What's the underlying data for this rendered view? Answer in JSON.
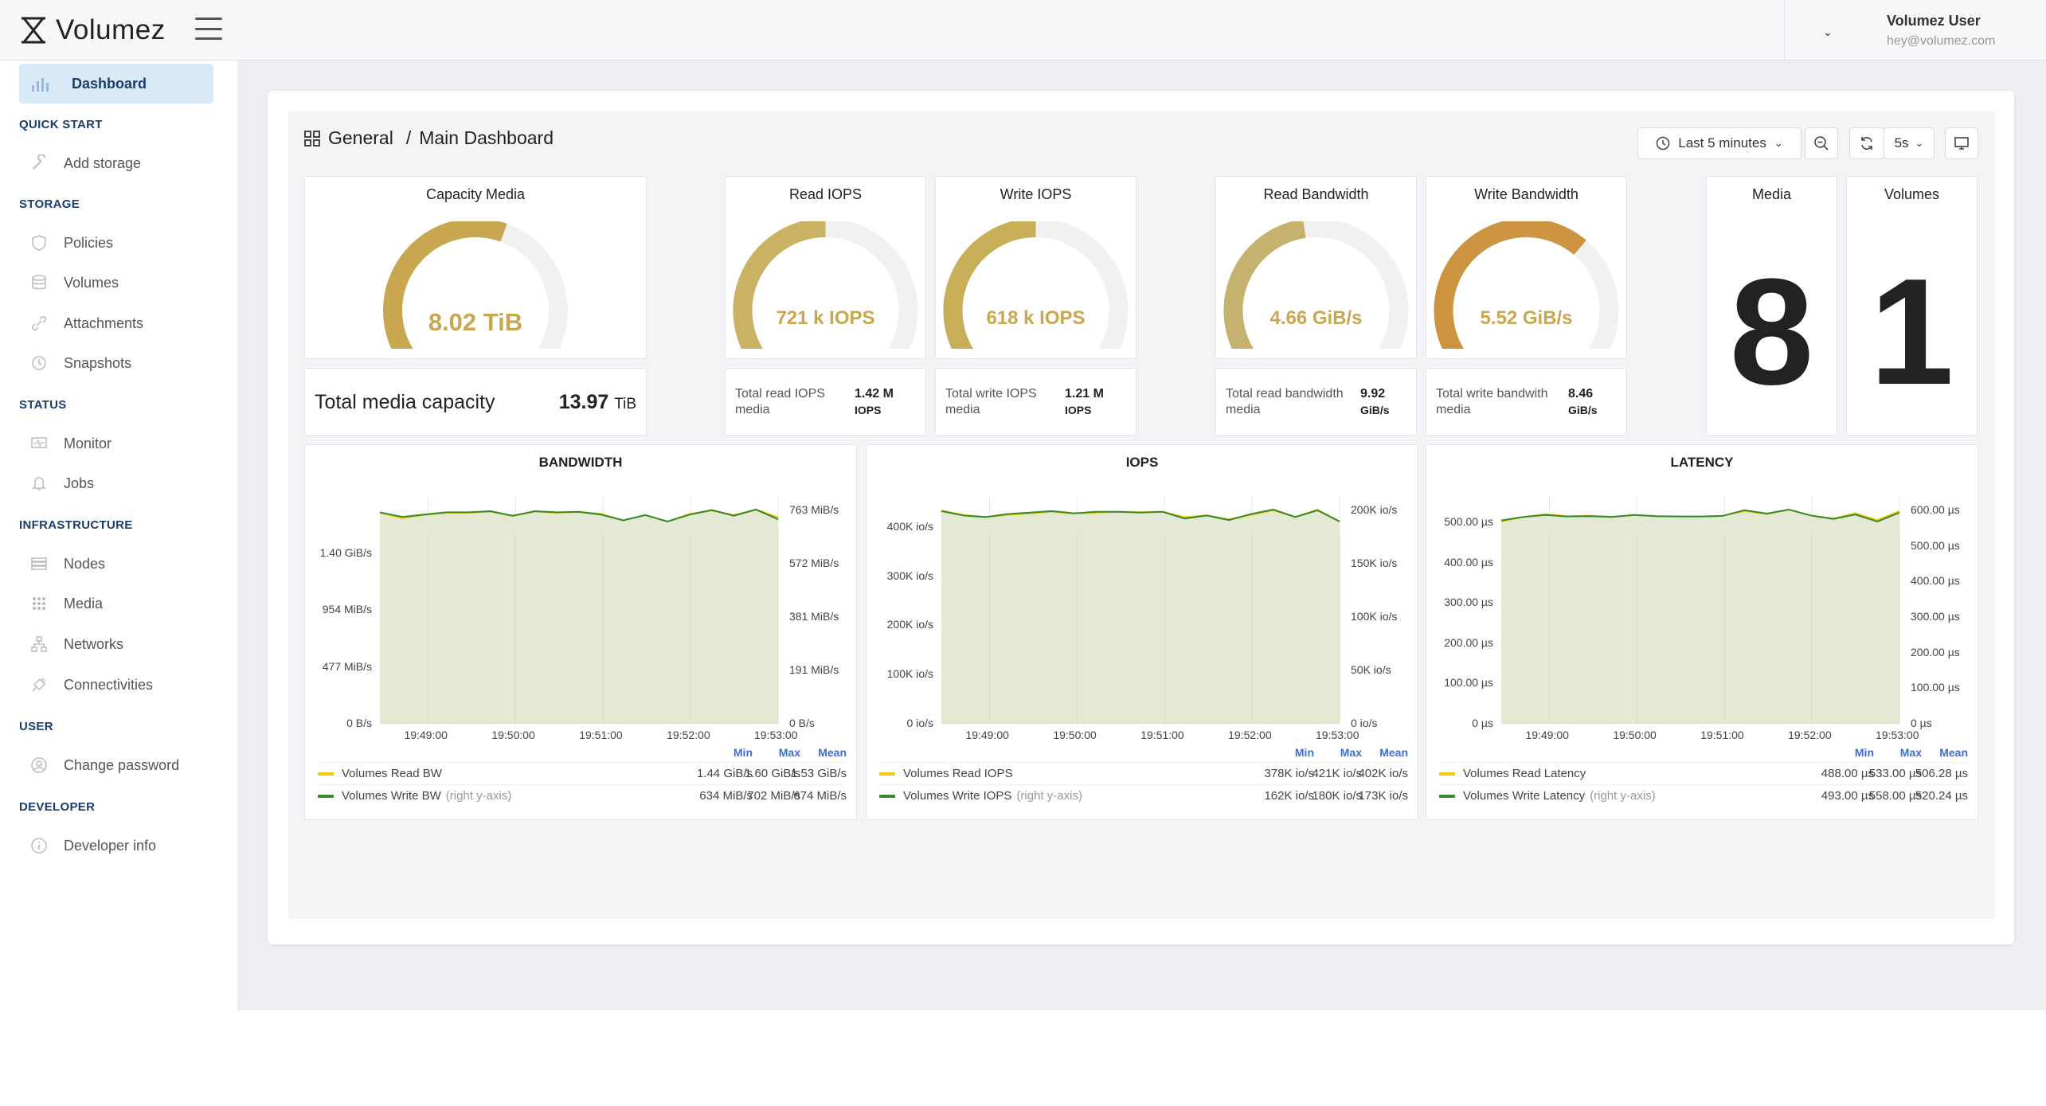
{
  "app": {
    "name": "Volumez"
  },
  "user": {
    "name": "Volumez User",
    "email": "hey@volumez.com"
  },
  "sidebar": {
    "dashboard": "Dashboard",
    "sections": [
      {
        "title": "QUICK START",
        "items": [
          "Add storage"
        ]
      },
      {
        "title": "STORAGE",
        "items": [
          "Policies",
          "Volumes",
          "Attachments",
          "Snapshots"
        ]
      },
      {
        "title": "STATUS",
        "items": [
          "Monitor",
          "Jobs"
        ]
      },
      {
        "title": "INFRASTRUCTURE",
        "items": [
          "Nodes",
          "Media",
          "Networks",
          "Connectivities"
        ]
      },
      {
        "title": "USER",
        "items": [
          "Change password"
        ]
      },
      {
        "title": "DEVELOPER",
        "items": [
          "Developer info"
        ]
      }
    ]
  },
  "header": {
    "breadcrumb_root": "General",
    "breadcrumb_sep": "/",
    "title": "Main Dashboard",
    "time_range": "Last 5 minutes",
    "refresh": "5s"
  },
  "panels": {
    "capacity": {
      "title": "Capacity Media",
      "value": "8.02 TiB",
      "fill": 0.574,
      "color": "#c9a751"
    },
    "total_capacity": {
      "label": "Total media capacity",
      "value": "13.97",
      "unit": "TiB"
    },
    "read_iops": {
      "title": "Read IOPS",
      "value": "721 k IOPS",
      "fill": 0.5,
      "color": "#c9b264"
    },
    "write_iops": {
      "title": "Write IOPS",
      "value": "618 k IOPS",
      "fill": 0.5,
      "color": "#c9ae58"
    },
    "read_bw": {
      "title": "Read Bandwidth",
      "value": "4.66 GiB/s",
      "fill": 0.47,
      "color": "#c4b26e"
    },
    "write_bw": {
      "title": "Write Bandwidth",
      "value": "5.52 GiB/s",
      "fill": 0.65,
      "color": "#cc9440"
    },
    "media": {
      "title": "Media",
      "value": "8"
    },
    "volumes": {
      "title": "Volumes",
      "value": "1"
    },
    "stat_read_iops": {
      "label1": "Total read IOPS",
      "label2": "media",
      "val1": "1.42 M",
      "val2": "IOPS"
    },
    "stat_write_iops": {
      "label1": "Total write IOPS",
      "label2": "media",
      "val1": "1.21 M",
      "val2": "IOPS"
    },
    "stat_read_bw": {
      "label1": "Total read bandwidth",
      "label2": "media",
      "val1": "9.92",
      "val2": "GiB/s"
    },
    "stat_write_bw": {
      "label1": "Total write bandwith",
      "label2": "media",
      "val1": "8.46",
      "val2": "GiB/s"
    }
  },
  "chart_data": [
    {
      "type": "line",
      "title": "BANDWIDTH",
      "x": [
        "19:49:00",
        "19:50:00",
        "19:51:00",
        "19:52:00",
        "19:53:00"
      ],
      "y_left_ticks": [
        "1.40 GiB/s",
        "954 MiB/s",
        "477 MiB/s",
        "0 B/s"
      ],
      "y_right_ticks": [
        "763 MiB/s",
        "572 MiB/s",
        "381 MiB/s",
        "191 MiB/s",
        "0 B/s"
      ],
      "legend_headers": [
        "Min",
        "Max",
        "Mean"
      ],
      "series": [
        {
          "name": "Volumes Read BW",
          "color": "#f2cc0c",
          "stats": [
            "1.44 GiB/s",
            "1.60 GiB/s",
            "1.53 GiB/s"
          ],
          "values": [
            1.55,
            1.5,
            1.53,
            1.55,
            1.55,
            1.56,
            1.52,
            1.56,
            1.55,
            1.56,
            1.54,
            1.48,
            1.53,
            1.47,
            1.54,
            1.57,
            1.53,
            1.58,
            1.51
          ]
        },
        {
          "name": "Volumes Write BW",
          "suffix": "(right y-axis)",
          "color": "#37872d",
          "stats": [
            "634 MiB/s",
            "702 MiB/s",
            "674 MiB/s"
          ],
          "values": [
            690,
            670,
            680,
            690,
            690,
            695,
            675,
            695,
            690,
            692,
            680,
            655,
            678,
            650,
            680,
            700,
            675,
            702,
            660
          ]
        }
      ]
    },
    {
      "type": "line",
      "title": "IOPS",
      "x": [
        "19:49:00",
        "19:50:00",
        "19:51:00",
        "19:52:00",
        "19:53:00"
      ],
      "y_left_ticks": [
        "400K io/s",
        "300K io/s",
        "200K io/s",
        "100K io/s",
        "0 io/s"
      ],
      "y_right_ticks": [
        "200K io/s",
        "150K io/s",
        "100K io/s",
        "50K io/s",
        "0 io/s"
      ],
      "legend_headers": [
        "Min",
        "Max",
        "Mean"
      ],
      "series": [
        {
          "name": "Volumes Read IOPS",
          "color": "#f2cc0c",
          "stats": [
            "378K io/s",
            "421K io/s",
            "402K io/s"
          ],
          "values": [
            415,
            405,
            400,
            405,
            408,
            412,
            408,
            410,
            412,
            411,
            412,
            400,
            404,
            395,
            405,
            415,
            400,
            417,
            390
          ]
        },
        {
          "name": "Volumes Write IOPS",
          "suffix": "(right y-axis)",
          "color": "#37872d",
          "stats": [
            "162K io/s",
            "180K io/s",
            "173K io/s"
          ],
          "values": [
            178,
            172,
            170,
            174,
            176,
            178,
            175,
            177,
            177,
            176,
            177,
            168,
            172,
            166,
            174,
            180,
            170,
            179,
            164
          ]
        }
      ]
    },
    {
      "type": "line",
      "title": "LATENCY",
      "x": [
        "19:49:00",
        "19:50:00",
        "19:51:00",
        "19:52:00",
        "19:53:00"
      ],
      "y_left_ticks": [
        "500.00 µs",
        "400.00 µs",
        "300.00 µs",
        "200.00 µs",
        "100.00 µs",
        "0 µs"
      ],
      "y_right_ticks": [
        "600.00 µs",
        "500.00 µs",
        "400.00 µs",
        "300.00 µs",
        "200.00 µs",
        "100.00 µs",
        "0 µs"
      ],
      "legend_headers": [
        "Min",
        "Max",
        "Mean"
      ],
      "series": [
        {
          "name": "Volumes Read Latency",
          "color": "#f2cc0c",
          "stats": [
            "488.00 µs",
            "533.00 µs",
            "506.28 µs"
          ],
          "values": [
            490,
            505,
            515,
            508,
            510,
            505,
            512,
            508,
            507,
            506,
            509,
            525,
            515,
            530,
            510,
            500,
            518,
            495,
            525
          ]
        },
        {
          "name": "Volumes Write Latency",
          "suffix": "(right y-axis)",
          "color": "#37872d",
          "stats": [
            "493.00 µs",
            "558.00 µs",
            "520.24 µs"
          ],
          "values": [
            500,
            518,
            528,
            520,
            522,
            518,
            528,
            522,
            520,
            520,
            523,
            552,
            535,
            555,
            525,
            508,
            530,
            495,
            540
          ]
        }
      ]
    }
  ]
}
